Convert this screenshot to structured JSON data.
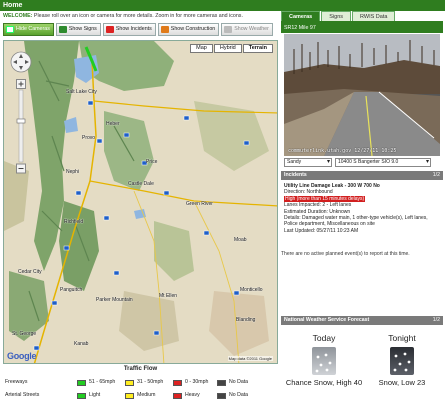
{
  "header": {
    "home": "Home",
    "welcome_prefix": "WELCOME:",
    "welcome_text": " Please roll over an icon or camera for more details. Zoom in for more cameras and icons."
  },
  "toolbar": {
    "buttons": [
      {
        "label": "Hide Cameras",
        "state": "active"
      },
      {
        "label": "Show Signs",
        "state": "normal"
      },
      {
        "label": "Show Incidents",
        "state": "normal"
      },
      {
        "label": "Show Construction",
        "state": "normal"
      },
      {
        "label": "Show Weather",
        "state": "disabled"
      }
    ]
  },
  "map": {
    "types": [
      "Map",
      "Hybrid",
      "Terrain"
    ],
    "selected_type": "Terrain",
    "cities": [
      "Salt Lake City",
      "Provo",
      "Heber",
      "Nephi",
      "Price",
      "Castle Dale",
      "Green River",
      "Richfield",
      "Cedar City",
      "St. George",
      "Kanab",
      "Panguitch",
      "Moab",
      "Monticello",
      "Blanding",
      "Parker Mountain",
      "Mt Ellen"
    ],
    "logo": "Google",
    "attribution": "Map data ©2011 Google"
  },
  "legend": {
    "title": "Traffic Flow",
    "rows": [
      {
        "label": "Freeways",
        "items": [
          {
            "text": "51 - 65mph",
            "color": "#22cc22"
          },
          {
            "text": "31 - 50mph",
            "color": "#ffee22"
          },
          {
            "text": "0 - 30mph",
            "color": "#dd2222"
          },
          {
            "text": "No Data",
            "color": "#444444"
          }
        ]
      },
      {
        "label": "Arterial Streets",
        "items": [
          {
            "text": "Light",
            "color": "#22cc22"
          },
          {
            "text": "Medium",
            "color": "#ffee22"
          },
          {
            "text": "Heavy",
            "color": "#dd2222"
          },
          {
            "text": "No Data",
            "color": "#444444"
          }
        ]
      }
    ]
  },
  "sidebar": {
    "tabs": [
      "Cameras",
      "Signs",
      "RWIS Data"
    ],
    "selected_tab": "Cameras",
    "camera": {
      "name": "SR12 Mile 97",
      "caption": "commuterlink.utah.gov  12/27/11 10:25",
      "city_select": "Sandy",
      "location_select": "10400 S Bangerter SIO 9.0"
    },
    "incidents": {
      "title": "Incidents",
      "page": "1/2",
      "lines": [
        {
          "text": "Utility Line Damage Leak - 300 W 700 No",
          "style": "bold"
        },
        {
          "text": "Direction: Northbound",
          "style": "normal"
        },
        {
          "text": "High (more than 15 minutes delays)",
          "style": "highlight"
        },
        {
          "text": "Lanes Impacted: 2 - Left lanes",
          "style": "normal"
        },
        {
          "text": "Estimated Duration: Unknown",
          "style": "normal"
        },
        {
          "text": "Details: Damaged water main, 1 other-type vehicle(s), Left lanes, Police department, Miscellaneous on site",
          "style": "normal"
        },
        {
          "text": "Last Updated: 05/27/11 10:23 AM",
          "style": "normal"
        }
      ],
      "none_text": "There are no active planned event(s) to report at this time."
    },
    "forecast": {
      "title": "National Weather Service Forecast",
      "page": "1/2",
      "periods": [
        {
          "name": "Today",
          "text": "Chance Snow, High 40",
          "icon": "snow-cloud-day-icon"
        },
        {
          "name": "Tonight",
          "text": "Snow, Low 23",
          "icon": "snow-night-icon"
        }
      ]
    }
  }
}
